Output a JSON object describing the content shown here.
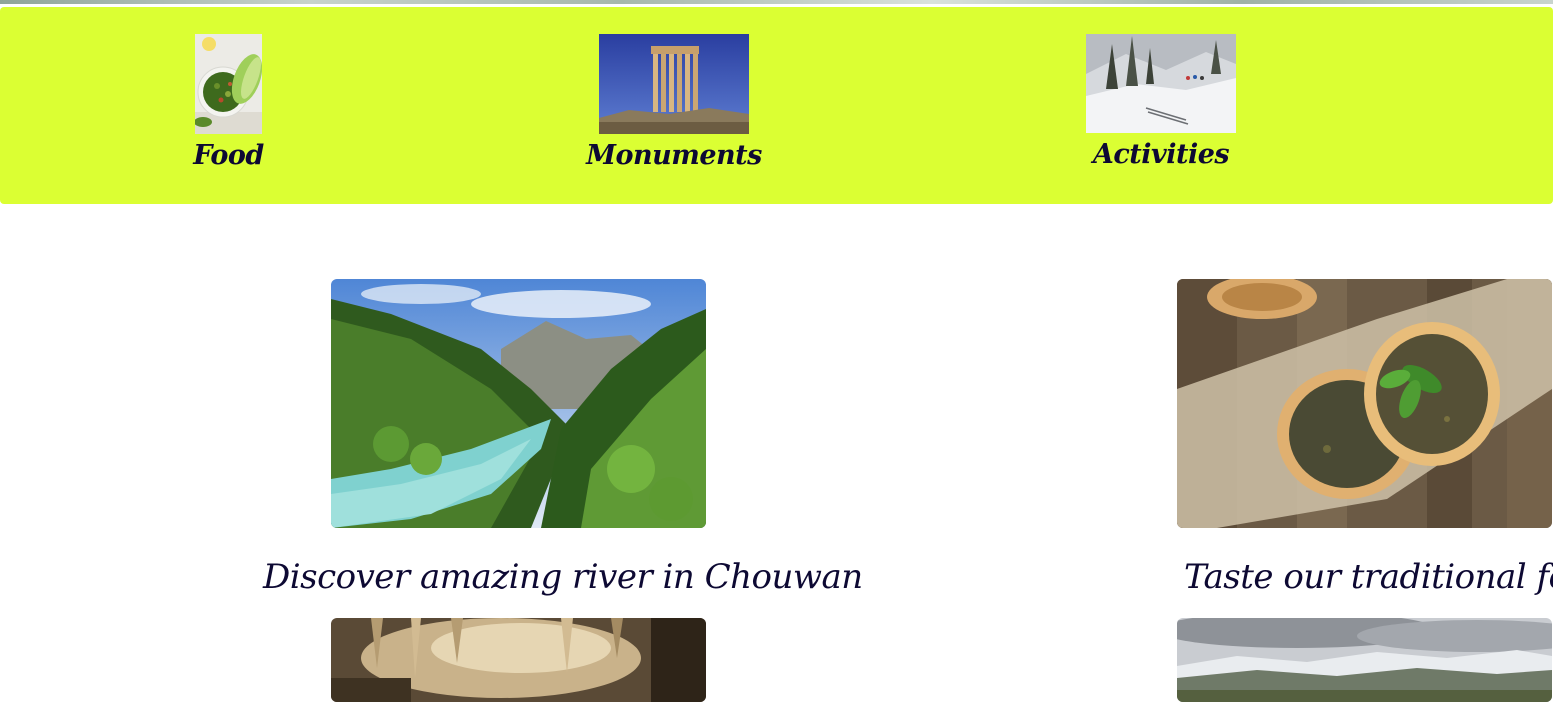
{
  "categories": [
    {
      "label": "Food",
      "image_icon": "herb-salad-bowl-image"
    },
    {
      "label": "Monuments",
      "image_icon": "temple-columns-image"
    },
    {
      "label": "Activities",
      "image_icon": "snow-skiing-image"
    }
  ],
  "features": [
    {
      "caption": "Discover amazing river in Chouwan",
      "image_icon": "river-valley-image"
    },
    {
      "caption": "Taste our traditional food",
      "image_icon": "manakish-flatbread-image"
    }
  ],
  "teasers": [
    {
      "image_icon": "cave-stalactites-image"
    },
    {
      "image_icon": "snowy-mountains-image"
    }
  ],
  "colors": {
    "category_bar": "#dbff33",
    "text": "#0d0933",
    "background": "#ffffff"
  }
}
